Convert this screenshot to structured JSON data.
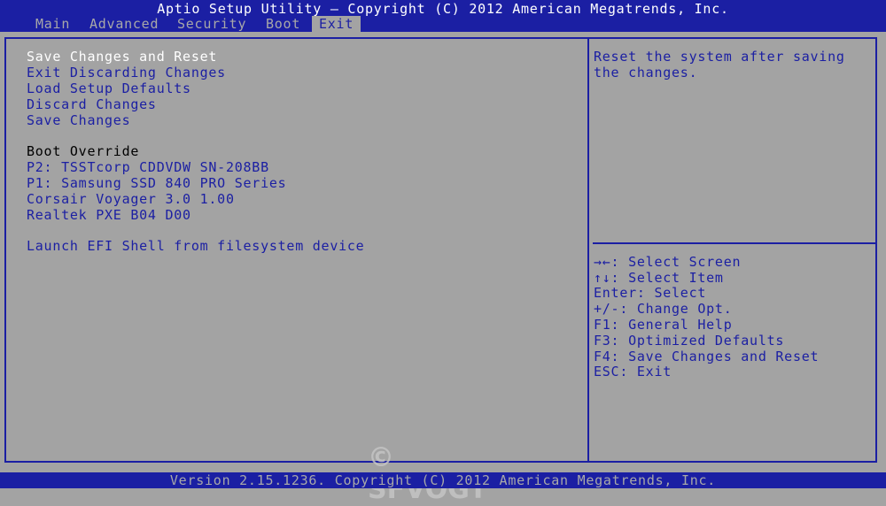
{
  "header": {
    "title": "Aptio Setup Utility – Copyright (C) 2012 American Megatrends, Inc."
  },
  "tabs": [
    {
      "label": "Main"
    },
    {
      "label": "Advanced"
    },
    {
      "label": "Security"
    },
    {
      "label": "Boot"
    },
    {
      "label": "Exit"
    }
  ],
  "active_tab": "Exit",
  "menu": {
    "items": [
      {
        "label": "Save Changes and Reset"
      },
      {
        "label": "Exit Discarding Changes"
      },
      {
        "label": "Load Setup Defaults"
      },
      {
        "label": "Discard Changes"
      },
      {
        "label": "Save Changes"
      }
    ],
    "boot_override_header": "Boot Override",
    "boot_items": [
      {
        "label": "P2: TSSTcorp CDDVDW SN-208BB"
      },
      {
        "label": "P1: Samsung SSD 840 PRO Series"
      },
      {
        "label": "Corsair Voyager 3.0 1.00"
      },
      {
        "label": "Realtek PXE B04 D00"
      }
    ],
    "efi_shell": "Launch EFI Shell from filesystem device"
  },
  "help": {
    "description": "Reset the system after saving the changes.",
    "keys": [
      "→←: Select Screen",
      "↑↓: Select Item",
      "Enter: Select",
      "+/-: Change Opt.",
      "F1: General Help",
      "F3: Optimized Defaults",
      "F4: Save Changes and Reset",
      "ESC: Exit"
    ]
  },
  "watermark": "© SFVOGT",
  "footer": {
    "text": "Version 2.15.1236. Copyright (C) 2012 American Megatrends, Inc."
  },
  "colors": {
    "bar_blue": "#1b1fa3",
    "panel_gray": "#a3a3a3",
    "selected_text": "#ffffff",
    "item_text": "#1b1fa3",
    "header_text": "#000000"
  }
}
